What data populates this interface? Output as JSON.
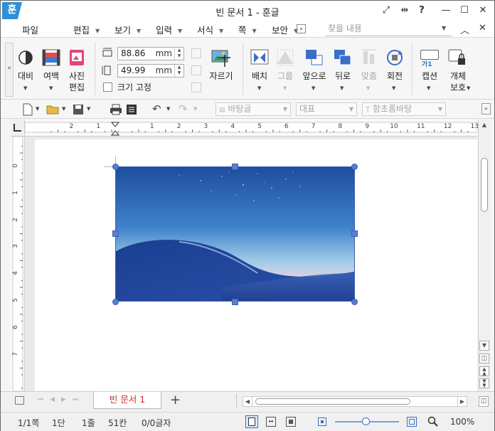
{
  "window": {
    "app_logo": "훈",
    "title": "빈 문서 1 - 훈글",
    "buttons": [
      "⤢",
      "⇹",
      "?",
      "—",
      "☐",
      "✕"
    ]
  },
  "menubar": {
    "items": [
      "파일",
      "편집",
      "보기",
      "입력",
      "서식",
      "쪽",
      "보안"
    ],
    "search_placeholder": "찾을 내용"
  },
  "ribbon": {
    "contrast_label": "대비",
    "margin_label": "여백",
    "photo_edit_label_1": "사진",
    "photo_edit_label_2": "편집",
    "width_value": "88.86",
    "height_value": "49.99",
    "unit": "mm",
    "lock_size_label": "크기 고정",
    "crop_label": "자르기",
    "arrange_label": "배치",
    "group_label": "그룹",
    "front_label": "앞으로",
    "back_label": "뒤로",
    "align_label": "맞춤",
    "rotate_label": "회전",
    "caption_label": "캡션",
    "caption_icon_text": "가1",
    "protect_label_1": "개체",
    "protect_label_2": "보호"
  },
  "toolbar2": {
    "style_combo": "바탕글",
    "para_combo": "대표",
    "font_combo": "함초롬바탕"
  },
  "ruler": {
    "h_labels": [
      "2",
      "1",
      "1",
      "2",
      "3",
      "4",
      "5",
      "6",
      "7",
      "8",
      "9",
      "10",
      "11",
      "12",
      "13"
    ],
    "v_labels": [
      "0",
      "1",
      "2",
      "3",
      "4",
      "5",
      "6",
      "7"
    ]
  },
  "tabs": {
    "doc_tab": "빈 문서 1",
    "add_tab": "+"
  },
  "status": {
    "page": "1/1쪽",
    "column": "1단",
    "line": "1줄",
    "char": "51칸",
    "count": "0/0글자",
    "zoom": "100%"
  },
  "colors": {
    "accent": "#2f8fd8",
    "tab_text": "#d12c2c",
    "handle": "#5a7fd0"
  }
}
